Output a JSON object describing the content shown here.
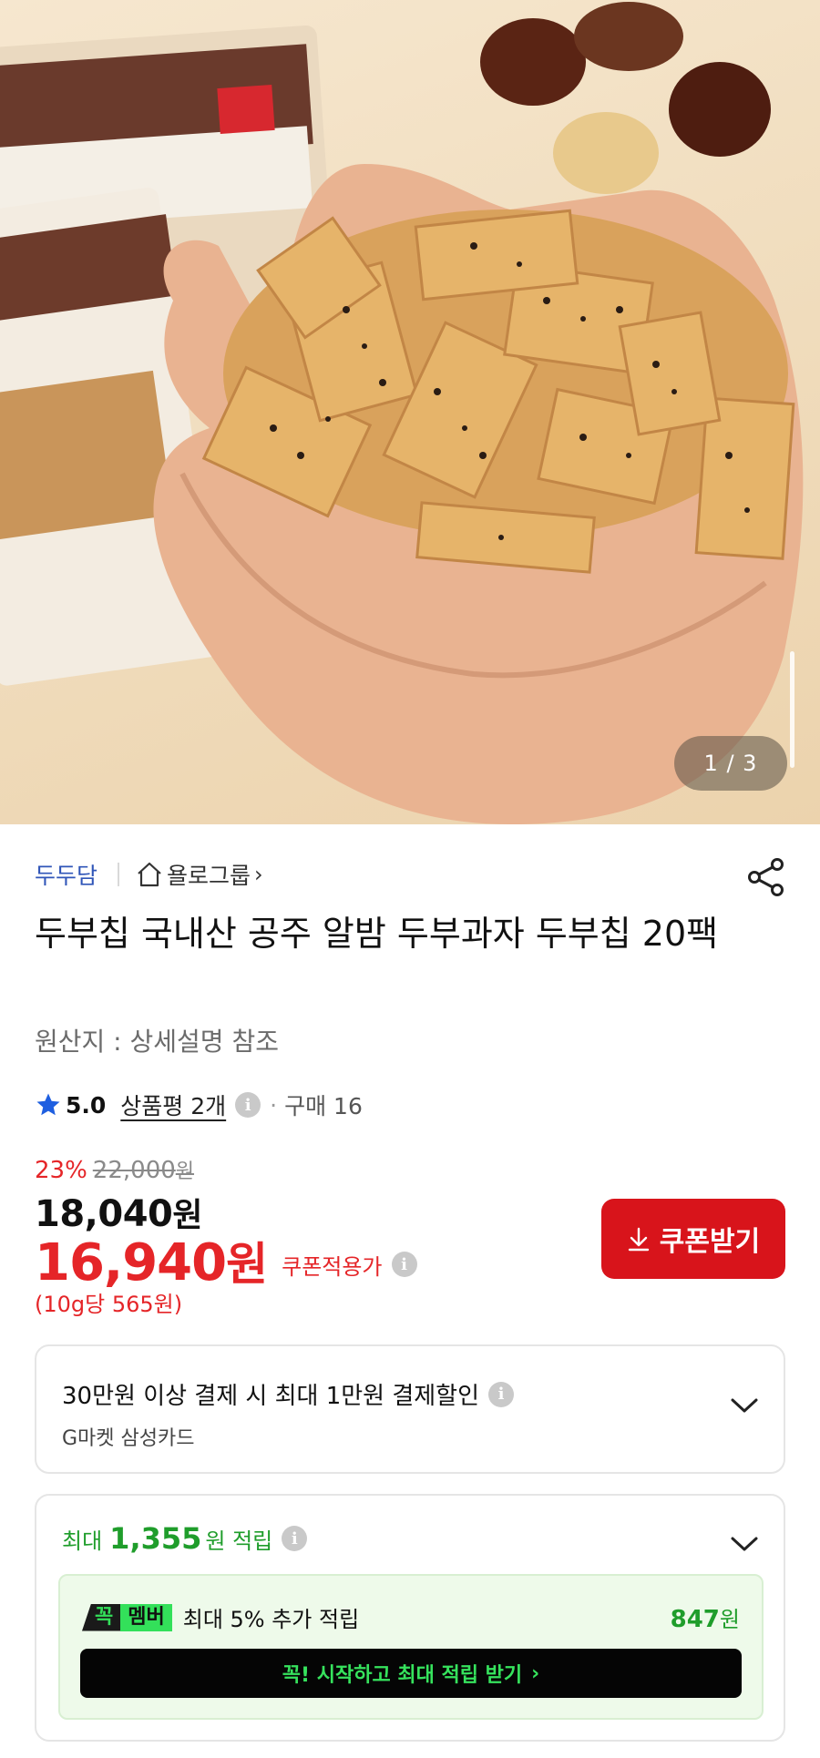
{
  "gallery": {
    "counter": "1 / 3"
  },
  "seller": {
    "brand": "두두담",
    "store": "욜로그룹",
    "store_chevron": "›"
  },
  "product": {
    "title": "두부칩 국내산 공주 알밤 두부과자 두부칩 20팩",
    "origin": "원산지 : 상세설명 참조"
  },
  "rating": {
    "score": "5.0",
    "reviews_label": "상품평 2개",
    "dot": "·",
    "purchases": "구매 16"
  },
  "price": {
    "discount_pct": "23%",
    "original": "22,000",
    "original_unit": "원",
    "sale_number": "18,040",
    "sale_unit": "원",
    "coupon_number": "16,940",
    "coupon_unit": "원",
    "coupon_label": "쿠폰적용가",
    "unit_price": "(10g당 565원)"
  },
  "coupon_button": {
    "label": "쿠폰받기"
  },
  "card_benefit": {
    "title": "30만원 이상 결제 시 최대 1만원 결제할인",
    "card": "G마켓 삼성카드"
  },
  "points": {
    "prefix": "최대",
    "amount": "1,355",
    "suffix": "원 적립",
    "member": {
      "badge_left": "꼭",
      "badge_right": "멤버",
      "text": "최대 5% 추가 적립",
      "amount": "847",
      "amount_unit": "원",
      "cta": "꼭! 시작하고 최대 적립 받기",
      "cta_arrow": "›"
    }
  },
  "colors": {
    "accent_red": "#d8141b",
    "price_red": "#e52528",
    "brand_blue": "#2f55b8",
    "point_green": "#1f9d2b",
    "member_green": "#33e05a",
    "rating_star": "#1f5fe0"
  },
  "icons": [
    "share-icon",
    "home-icon",
    "star-icon",
    "info-icon",
    "download-icon",
    "chevron-down-icon"
  ]
}
